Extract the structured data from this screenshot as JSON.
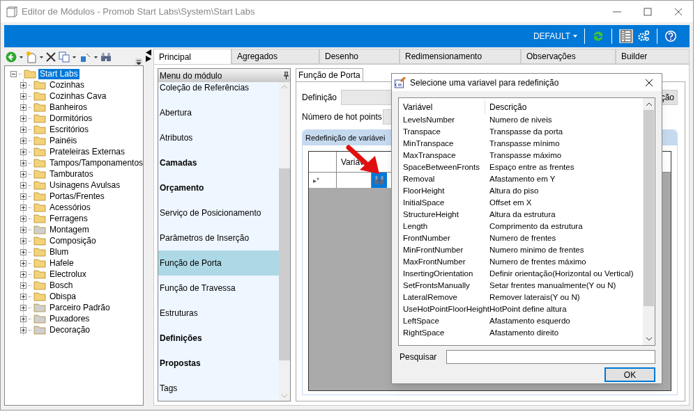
{
  "window": {
    "title": "Editor de Módulos - Promob Start Labs\\System\\Start Labs"
  },
  "ribbon": {
    "profile": "DEFAULT"
  },
  "tree": {
    "label": "Start Labs",
    "selected": true,
    "expanded": true,
    "children": [
      {
        "label": "Cozinhas",
        "expanded": false,
        "color": "#f3d27a"
      },
      {
        "label": "Cozinhas Cava",
        "expanded": false,
        "color": "#f3d27a"
      },
      {
        "label": "Banheiros",
        "expanded": false,
        "color": "#f3d27a"
      },
      {
        "label": "Dormitórios",
        "expanded": false,
        "color": "#f3d27a"
      },
      {
        "label": "Escritórios",
        "expanded": false,
        "color": "#f3d27a"
      },
      {
        "label": "Painéis",
        "expanded": false,
        "color": "#f3d27a"
      },
      {
        "label": "Prateleiras Externas",
        "expanded": false,
        "color": "#f3d27a"
      },
      {
        "label": "Tampos/Tamponamentos",
        "expanded": false,
        "color": "#f3d27a"
      },
      {
        "label": "Tamburatos",
        "expanded": false,
        "color": "#f3d27a"
      },
      {
        "label": "Usinagens Avulsas",
        "expanded": false,
        "color": "#f3d27a"
      },
      {
        "label": "Portas/Frentes",
        "expanded": false,
        "color": "#f3d27a"
      },
      {
        "label": "Acessórios",
        "expanded": false,
        "color": "#f3d27a"
      },
      {
        "label": "Ferragens",
        "expanded": false,
        "color": "#f3d27a"
      },
      {
        "label": "Montagem",
        "expanded": false,
        "color": "#cfcfcf"
      },
      {
        "label": "Composição",
        "expanded": false,
        "color": "#f3d27a"
      },
      {
        "label": "Blum",
        "expanded": false,
        "color": "#f3d27a"
      },
      {
        "label": "Hafele",
        "expanded": false,
        "color": "#f3d27a"
      },
      {
        "label": "Electrolux",
        "expanded": false,
        "color": "#f3d27a"
      },
      {
        "label": "Bosch",
        "expanded": false,
        "color": "#f3d27a"
      },
      {
        "label": "Obispa",
        "expanded": false,
        "color": "#f3d27a"
      },
      {
        "label": "Parceiro Padrão",
        "expanded": false,
        "color": "#cfcfcf"
      },
      {
        "label": "Puxadores",
        "expanded": false,
        "color": "#cfcfcf"
      },
      {
        "label": "Decoração",
        "expanded": false,
        "color": "#cfcfcf"
      }
    ]
  },
  "tabs": [
    {
      "label": "Principal",
      "selected": true
    },
    {
      "label": "Agregados",
      "selected": false
    },
    {
      "label": "Desenho",
      "selected": false
    },
    {
      "label": "Redimensionamento",
      "selected": false
    },
    {
      "label": "Observações",
      "selected": false
    },
    {
      "label": "Builder",
      "selected": false
    }
  ],
  "module_menu": {
    "title": "Menu do módulo",
    "items": [
      {
        "label": "Coleção de Referências",
        "bold": false,
        "selected": false
      },
      {
        "label": "Abertura",
        "bold": false,
        "selected": false
      },
      {
        "label": "Atributos",
        "bold": false,
        "selected": false
      },
      {
        "label": "Camadas",
        "bold": true,
        "selected": false
      },
      {
        "label": "Orçamento",
        "bold": true,
        "selected": false
      },
      {
        "label": "Serviço de Posicionamento",
        "bold": false,
        "selected": false
      },
      {
        "label": "Parâmetros de Inserção",
        "bold": false,
        "selected": false
      },
      {
        "label": "Função de Porta",
        "bold": false,
        "selected": true
      },
      {
        "label": "Função de Travessa",
        "bold": false,
        "selected": false
      },
      {
        "label": "Estruturas",
        "bold": false,
        "selected": false
      },
      {
        "label": "Definições",
        "bold": true,
        "selected": false
      },
      {
        "label": "Propostas",
        "bold": true,
        "selected": false
      },
      {
        "label": "Tags",
        "bold": false,
        "selected": false
      }
    ]
  },
  "sub_tab": {
    "label": "Função de Porta"
  },
  "form": {
    "definition_label": "Definição",
    "hotpoints_label": "Número de hot points",
    "button_text": "ção"
  },
  "group": {
    "title": "Redefinição de variávei",
    "column": "Variáv",
    "row_marker": "▸*"
  },
  "dialog": {
    "title": "Selecione uma variavel para redefinição",
    "columns": [
      "Variável",
      "Descrição"
    ],
    "rows": [
      [
        "LevelsNumber",
        "Numero de niveis"
      ],
      [
        "Transpace",
        "Transpasse da porta"
      ],
      [
        "MinTranspace",
        "Transpasse mínimo"
      ],
      [
        "MaxTranspace",
        "Transpasse máximo"
      ],
      [
        "SpaceBetweenFronts",
        "Espaço entre as frentes"
      ],
      [
        "Removal",
        "Afastamento em Y"
      ],
      [
        "FloorHeight",
        "Altura do piso"
      ],
      [
        "InitialSpace",
        "Offset em X"
      ],
      [
        "StructureHeight",
        "Altura da estrutura"
      ],
      [
        "Length",
        "Comprimento da estrutura"
      ],
      [
        "FrontNumber",
        "Numero de frentes"
      ],
      [
        "MinFrontNumber",
        "Numero minimo de frentes"
      ],
      [
        "MaxFrontNumber",
        "Numero de frentes máximo"
      ],
      [
        "InsertingOrientation",
        "Definir orientação(Horizontal ou Vertical)"
      ],
      [
        "SetFrontsManually",
        "Setar frentes manualmente(Y ou N)"
      ],
      [
        "LateralRemove",
        "Remover laterais(Y ou N)"
      ],
      [
        "UseHotPointFloorHeight",
        "HotPoint define altura"
      ],
      [
        "LeftSpace",
        "Afastamento esquerdo"
      ],
      [
        "RightSpace",
        "Afastamento direito"
      ]
    ],
    "search_label": "Pesquisar",
    "ok": "OK"
  }
}
